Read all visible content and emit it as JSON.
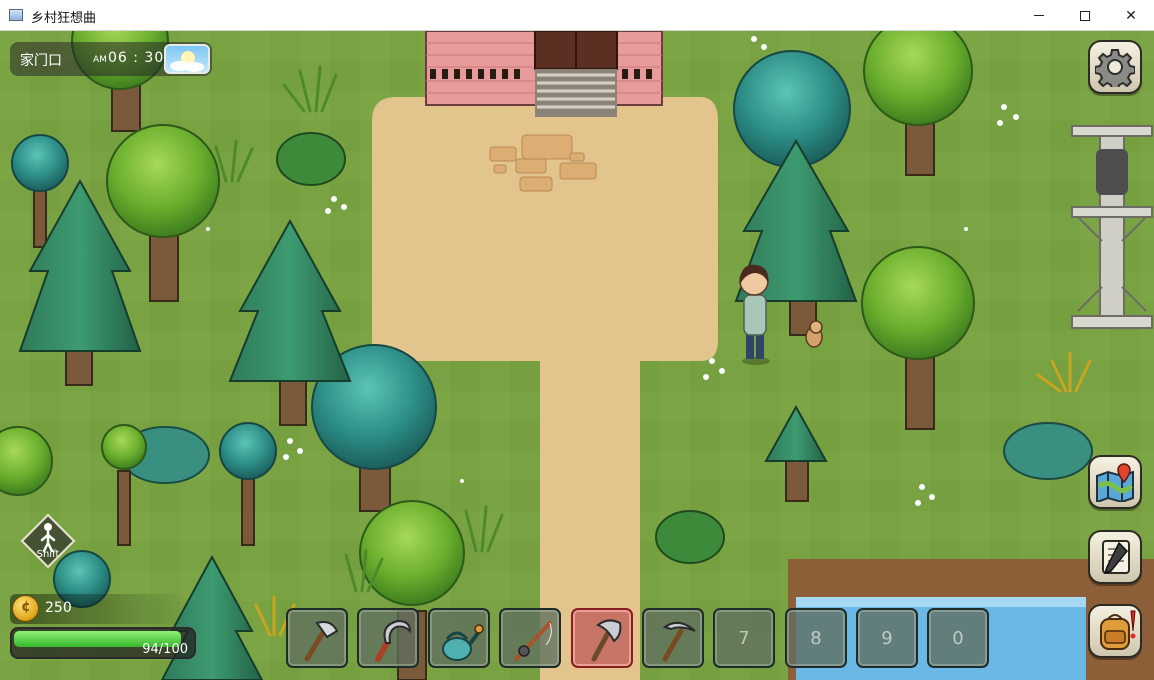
{
  "window": {
    "title": "乡村狂想曲",
    "minimize_glyph": "",
    "maximize_glyph": "",
    "close_glyph": "✕"
  },
  "hud": {
    "location": "家门口",
    "ampm": "AM",
    "time": "06 : 30",
    "weather_icon": "sunny-cloud-icon",
    "money": "250",
    "stamina_text": "94/100",
    "stamina_fraction": 0.94,
    "run_label": "Shift"
  },
  "hotbar": {
    "slots": [
      {
        "item": "axe-icon",
        "label": ""
      },
      {
        "item": "sickle-icon",
        "label": ""
      },
      {
        "item": "watering-can-icon",
        "label": ""
      },
      {
        "item": "fishing-rod-icon",
        "label": ""
      },
      {
        "item": "axe-icon",
        "label": "",
        "selected": true
      },
      {
        "item": "pickaxe-icon",
        "label": ""
      },
      {
        "item": "",
        "label": "7"
      },
      {
        "item": "",
        "label": "8"
      },
      {
        "item": "",
        "label": "9"
      },
      {
        "item": "",
        "label": "0"
      }
    ]
  },
  "side_buttons": [
    "gear-icon",
    "map-icon",
    "journal-icon",
    "backpack-icon"
  ],
  "colors": {
    "grass": "#79a243",
    "path": "#e8c690",
    "selected_slot": "#be5a5a",
    "stamina": "#37b82b",
    "water": "#6bb8e6"
  }
}
